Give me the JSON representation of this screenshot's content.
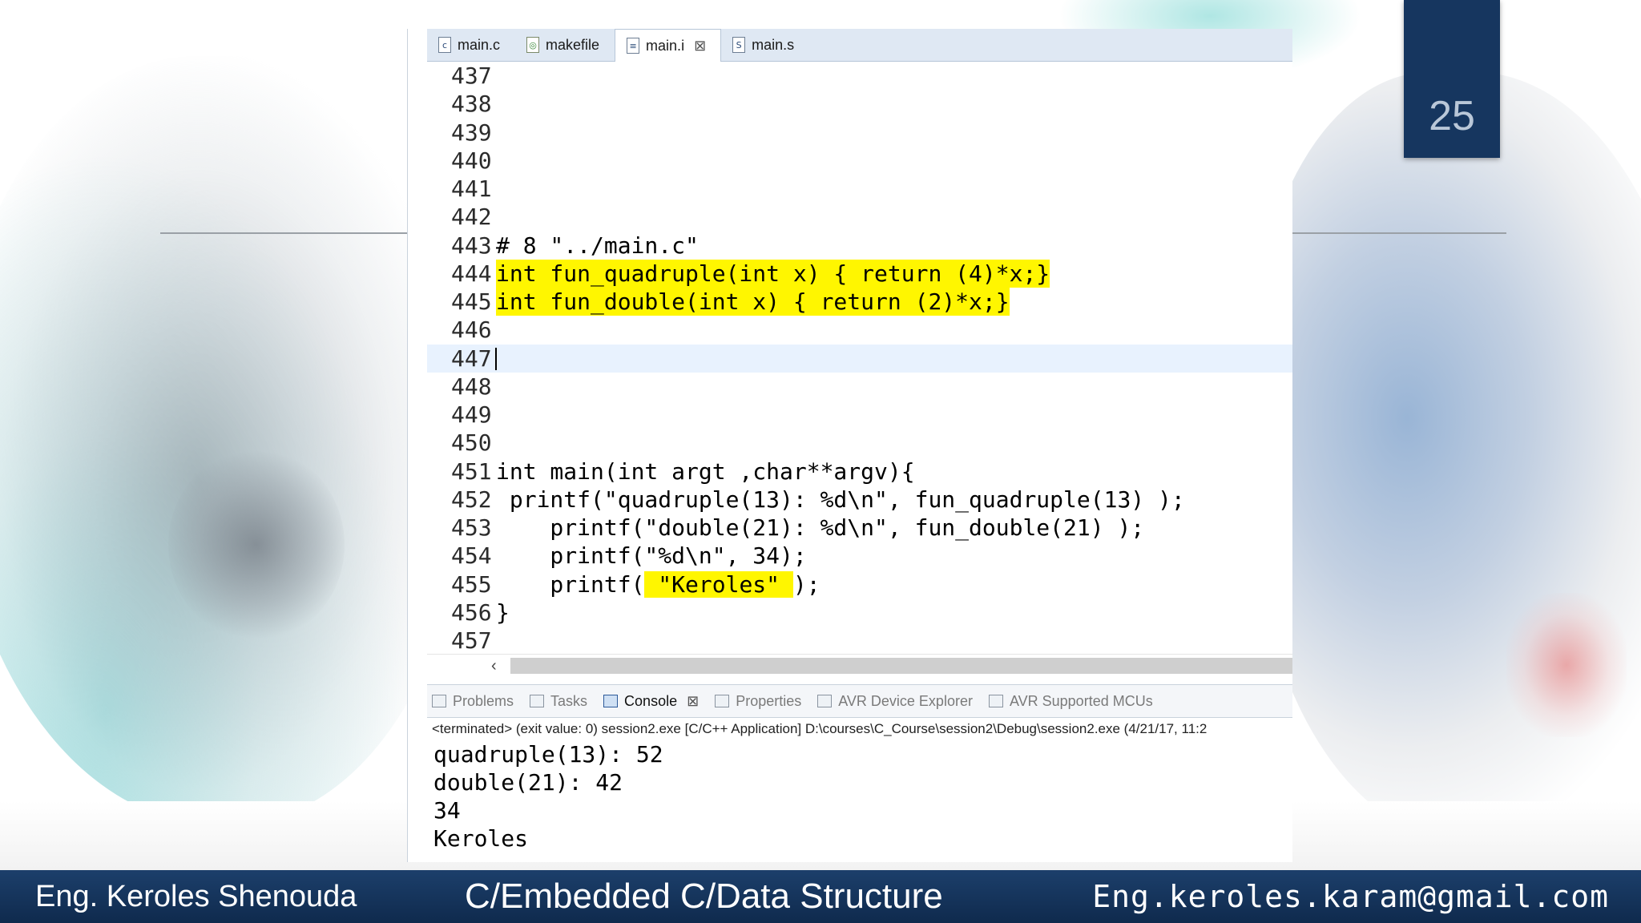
{
  "slide": {
    "page_number": "25",
    "footer": {
      "author": "Eng. Keroles Shenouda",
      "course": "C/Embedded C/Data Structure",
      "email": "Eng.keroles.karam@gmail.com"
    }
  },
  "editor": {
    "tabs": [
      {
        "label": "main.c",
        "icon": "c-file-icon",
        "active": false
      },
      {
        "label": "makefile",
        "icon": "makefile-icon",
        "active": false
      },
      {
        "label": "main.i",
        "icon": "text-file-icon",
        "active": true,
        "closable": true
      },
      {
        "label": "main.s",
        "icon": "asm-file-icon",
        "active": false
      }
    ],
    "lines": [
      {
        "num": "437",
        "code": ""
      },
      {
        "num": "438",
        "code": ""
      },
      {
        "num": "439",
        "code": ""
      },
      {
        "num": "440",
        "code": ""
      },
      {
        "num": "441",
        "code": ""
      },
      {
        "num": "442",
        "code": ""
      },
      {
        "num": "443",
        "code": "# 8 \"../main.c\""
      },
      {
        "num": "444",
        "code": "int fun_quadruple(int x) { return (4)*x;}"
      },
      {
        "num": "445",
        "code": "int fun_double(int x) { return (2)*x;}"
      },
      {
        "num": "446",
        "code": ""
      },
      {
        "num": "447",
        "code": ""
      },
      {
        "num": "448",
        "code": ""
      },
      {
        "num": "449",
        "code": ""
      },
      {
        "num": "450",
        "code": ""
      },
      {
        "num": "451",
        "code": "int main(int argt ,char**argv){"
      },
      {
        "num": "452",
        "code": " printf(\"quadruple(13): %d\\n\", fun_quadruple(13) );"
      },
      {
        "num": "453",
        "code": "    printf(\"double(21): %d\\n\", fun_double(21) );"
      },
      {
        "num": "454",
        "code": "    printf(\"%d\\n\", 34);"
      },
      {
        "num": "455",
        "pre": "    printf(",
        "highlight": " \"Keroles\" ",
        "post": ");"
      },
      {
        "num": "456",
        "code": "}"
      },
      {
        "num": "457",
        "code": ""
      }
    ],
    "highlight_color": "#fff600",
    "current_line": "447"
  },
  "views": {
    "tabs": [
      {
        "label": "Problems",
        "icon": "problems-icon"
      },
      {
        "label": "Tasks",
        "icon": "tasks-icon"
      },
      {
        "label": "Console",
        "icon": "console-icon",
        "active": true
      },
      {
        "label": "Properties",
        "icon": "properties-icon"
      },
      {
        "label": "AVR Device Explorer",
        "icon": "chip-icon"
      },
      {
        "label": "AVR Supported MCUs",
        "icon": "chip-icon"
      }
    ],
    "console_status": "<terminated> (exit value: 0) session2.exe [C/C++ Application] D:\\courses\\C_Course\\session2\\Debug\\session2.exe (4/21/17, 11:2",
    "console_output": [
      "quadruple(13): 52",
      "double(21): 42",
      "34",
      "Keroles"
    ]
  },
  "colors": {
    "footer_bg": "#16365f",
    "badge_bg": "#16365f",
    "tab_bar": "#dfe8f3"
  }
}
